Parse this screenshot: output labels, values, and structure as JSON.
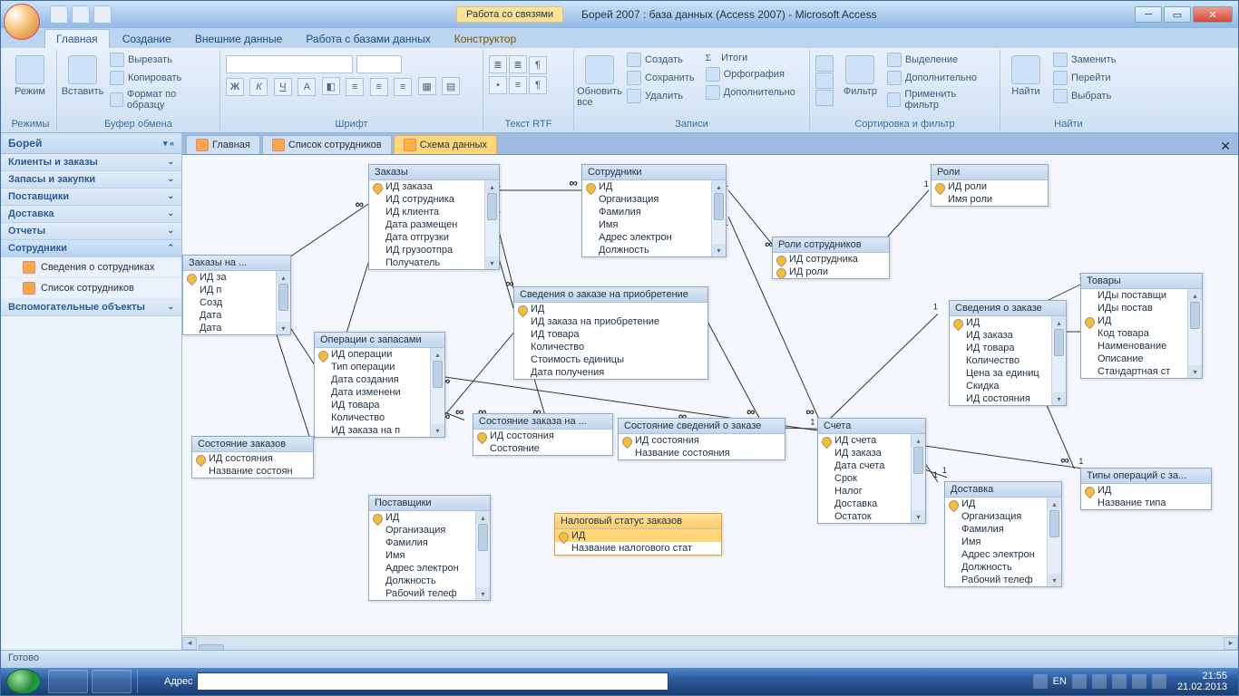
{
  "window": {
    "contextual_tab_group": "Работа со связями",
    "title": "Борей 2007 : база данных (Access 2007) - Microsoft Access"
  },
  "ribbon_tabs": [
    "Главная",
    "Создание",
    "Внешние данные",
    "Работа с базами данных",
    "Конструктор"
  ],
  "ribbon": {
    "modes": {
      "label": "Режимы",
      "btn": "Режим"
    },
    "clipboard": {
      "label": "Буфер обмена",
      "paste": "Вставить",
      "cut": "Вырезать",
      "copy": "Копировать",
      "fmt": "Формат по образцу"
    },
    "font": {
      "label": "Шрифт"
    },
    "rtf": {
      "label": "Текст RTF"
    },
    "records": {
      "label": "Записи",
      "refresh": "Обновить все",
      "new": "Создать",
      "save": "Сохранить",
      "delete": "Удалить",
      "totals": "Итоги",
      "spell": "Орфография",
      "more": "Дополнительно"
    },
    "sort": {
      "label": "Сортировка и фильтр",
      "filter": "Фильтр",
      "sel": "Выделение",
      "adv": "Дополнительно",
      "toggle": "Применить фильтр"
    },
    "find": {
      "label": "Найти",
      "find_btn": "Найти",
      "replace": "Заменить",
      "goto": "Перейти",
      "select": "Выбрать"
    }
  },
  "nav": {
    "title": "Борей",
    "groups": [
      {
        "label": "Клиенты и заказы",
        "expanded": false
      },
      {
        "label": "Запасы и закупки",
        "expanded": false
      },
      {
        "label": "Поставщики",
        "expanded": false
      },
      {
        "label": "Доставка",
        "expanded": false
      },
      {
        "label": "Отчеты",
        "expanded": false
      },
      {
        "label": "Сотрудники",
        "expanded": true,
        "items": [
          "Сведения о сотрудниках",
          "Список сотрудников"
        ]
      },
      {
        "label": "Вспомогательные объекты",
        "expanded": false
      }
    ]
  },
  "doc_tabs": [
    "Главная",
    "Список сотрудников",
    "Схема данных"
  ],
  "tables": {
    "zakazy": {
      "title": "Заказы",
      "fields": [
        {
          "n": "ИД заказа",
          "k": 1
        },
        {
          "n": "ИД сотрудника"
        },
        {
          "n": "ИД клиента"
        },
        {
          "n": "Дата размещен"
        },
        {
          "n": "Дата отгрузки"
        },
        {
          "n": "ИД грузоотпра"
        },
        {
          "n": "Получатель"
        }
      ]
    },
    "zakazy_na": {
      "title": "Заказы на ...",
      "fields": [
        {
          "n": "ИД за",
          "k": 1
        },
        {
          "n": "ИД п"
        },
        {
          "n": "Созд"
        },
        {
          "n": "Дата"
        },
        {
          "n": "Дата"
        }
      ]
    },
    "oper": {
      "title": "Операции с запасами",
      "fields": [
        {
          "n": "ИД операции",
          "k": 1
        },
        {
          "n": "Тип операции"
        },
        {
          "n": "Дата создания"
        },
        {
          "n": "Дата изменени"
        },
        {
          "n": "ИД товара"
        },
        {
          "n": "Количество"
        },
        {
          "n": "ИД заказа на п"
        }
      ]
    },
    "sost_z": {
      "title": "Состояние заказов",
      "fields": [
        {
          "n": "ИД состояния",
          "k": 1
        },
        {
          "n": "Название состоян"
        }
      ]
    },
    "post": {
      "title": "Поставщики",
      "fields": [
        {
          "n": "ИД",
          "k": 1
        },
        {
          "n": "Организация"
        },
        {
          "n": "Фамилия"
        },
        {
          "n": "Имя"
        },
        {
          "n": "Адрес электрон"
        },
        {
          "n": "Должность"
        },
        {
          "n": "Рабочий телеф"
        }
      ]
    },
    "sved_pr": {
      "title": "Сведения о заказе на приобретение",
      "fields": [
        {
          "n": "ИД",
          "k": 1
        },
        {
          "n": "ИД заказа на приобретение"
        },
        {
          "n": "ИД товара"
        },
        {
          "n": "Количество"
        },
        {
          "n": "Стоимость единицы"
        },
        {
          "n": "Дата получения"
        }
      ]
    },
    "sost_zna": {
      "title": "Состояние заказа на ...",
      "fields": [
        {
          "n": "ИД состояния",
          "k": 1
        },
        {
          "n": "Состояние"
        }
      ]
    },
    "nalog": {
      "title": "Налоговый статус заказов",
      "fields": [
        {
          "n": "ИД",
          "k": 1,
          "sel": 1
        },
        {
          "n": "Название налогового стат"
        }
      ]
    },
    "sotr": {
      "title": "Сотрудники",
      "fields": [
        {
          "n": "ИД",
          "k": 1
        },
        {
          "n": "Организация"
        },
        {
          "n": "Фамилия"
        },
        {
          "n": "Имя"
        },
        {
          "n": "Адрес электрон"
        },
        {
          "n": "Должность"
        }
      ]
    },
    "sost_sv": {
      "title": "Состояние сведений о заказе",
      "fields": [
        {
          "n": "ИД состояния",
          "k": 1
        },
        {
          "n": "Название состояния"
        }
      ]
    },
    "roli_s": {
      "title": "Роли сотрудников",
      "fields": [
        {
          "n": "ИД сотрудника",
          "k": 1
        },
        {
          "n": "ИД роли",
          "k": 1
        }
      ]
    },
    "scheta": {
      "title": "Счета",
      "fields": [
        {
          "n": "ИД счета",
          "k": 1
        },
        {
          "n": "ИД заказа"
        },
        {
          "n": "Дата счета"
        },
        {
          "n": "Срок"
        },
        {
          "n": "Налог"
        },
        {
          "n": "Доставка"
        },
        {
          "n": "Остаток"
        }
      ]
    },
    "roli": {
      "title": "Роли",
      "fields": [
        {
          "n": "ИД роли",
          "k": 1
        },
        {
          "n": "Имя роли"
        }
      ]
    },
    "sved_z": {
      "title": "Сведения о заказе",
      "fields": [
        {
          "n": "ИД",
          "k": 1
        },
        {
          "n": "ИД заказа"
        },
        {
          "n": "ИД товара"
        },
        {
          "n": "Количество"
        },
        {
          "n": "Цена за единиц"
        },
        {
          "n": "Скидка"
        },
        {
          "n": "ИД состояния"
        }
      ]
    },
    "dost": {
      "title": "Доставка",
      "fields": [
        {
          "n": "ИД",
          "k": 1
        },
        {
          "n": "Организация"
        },
        {
          "n": "Фамилия"
        },
        {
          "n": "Имя"
        },
        {
          "n": "Адрес электрон"
        },
        {
          "n": "Должность"
        },
        {
          "n": "Рабочий телеф"
        }
      ]
    },
    "tovary": {
      "title": "Товары",
      "fields": [
        {
          "n": "ИДы поставщи"
        },
        {
          "n": "ИДы постав"
        },
        {
          "n": "ИД",
          "k": 1
        },
        {
          "n": "Код товара"
        },
        {
          "n": "Наименование"
        },
        {
          "n": "Описание"
        },
        {
          "n": "Стандартная ст"
        }
      ]
    },
    "tipy": {
      "title": "Типы операций с за...",
      "fields": [
        {
          "n": "ИД",
          "k": 1
        },
        {
          "n": "Название типа"
        }
      ]
    }
  },
  "status": "Готово",
  "taskbar": {
    "address_label": "Адрес",
    "lang": "EN",
    "time": "21:55",
    "date": "21.02.2013"
  }
}
